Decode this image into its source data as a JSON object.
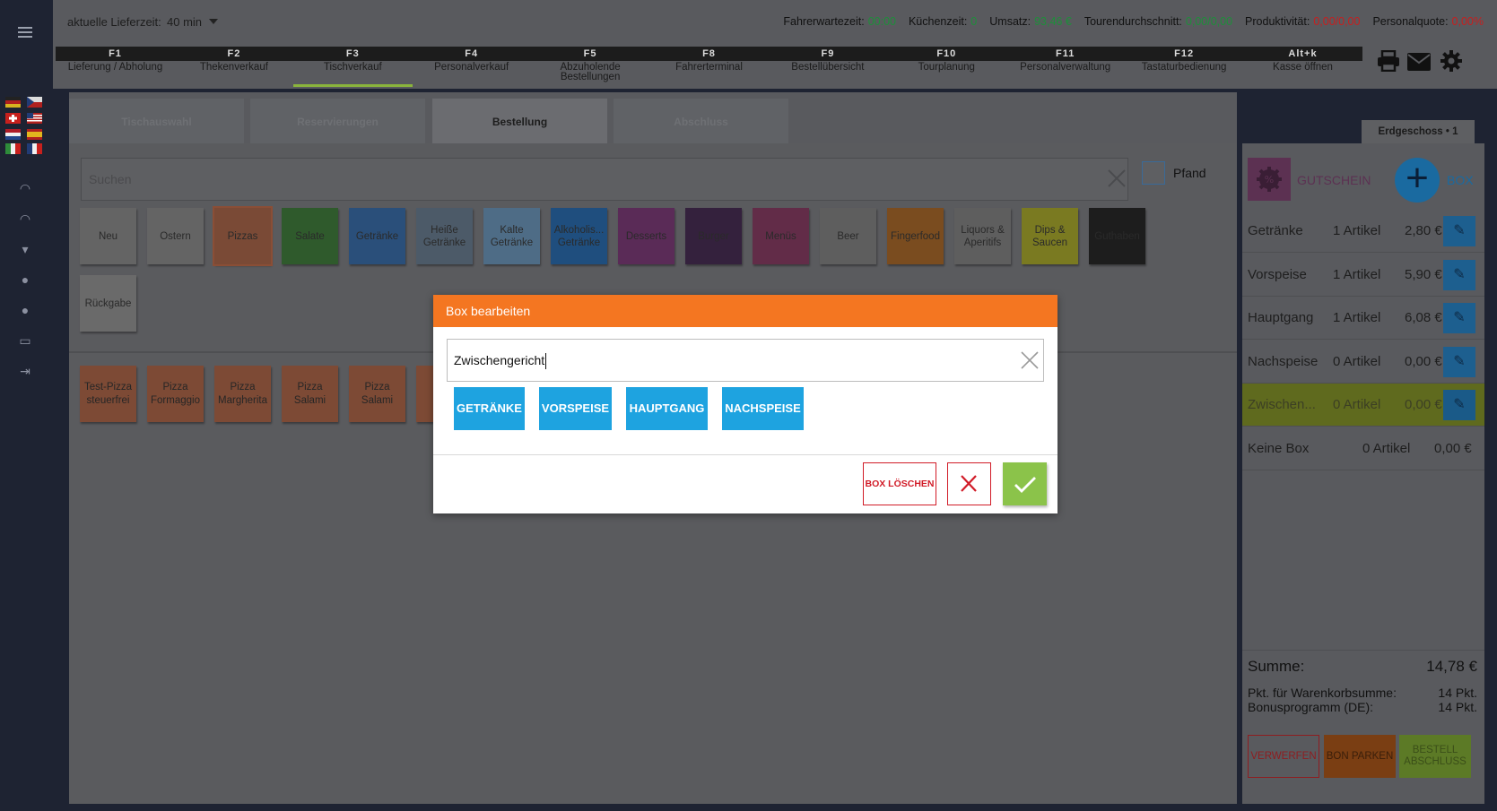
{
  "topbar": {
    "delivery_label": "aktuelle Lieferzeit:",
    "delivery_value": "40 min",
    "stats": [
      {
        "label": "Fahrerwartezeit:",
        "value": "00:00",
        "tone": "g"
      },
      {
        "label": "Küchenzeit:",
        "value": "0",
        "tone": "g"
      },
      {
        "label": "Umsatz:",
        "value": "93,46 €",
        "tone": "g"
      },
      {
        "label": "Tourendurchschnitt:",
        "value": "0,00/0,00",
        "tone": "g"
      },
      {
        "label": "Produktivität:",
        "value": "0,00/0,00",
        "tone": "r"
      },
      {
        "label": "Personalquote:",
        "value": "0,00%",
        "tone": "r"
      }
    ]
  },
  "fkeys": [
    {
      "key": "F1",
      "label": "Lieferung / Abholung"
    },
    {
      "key": "F2",
      "label": "Thekenverkauf"
    },
    {
      "key": "F3",
      "label": "Tischverkauf"
    },
    {
      "key": "F4",
      "label": "Personalverkauf"
    },
    {
      "key": "F5",
      "label": "Abzuholende Bestellungen"
    },
    {
      "key": "F8",
      "label": "Fahrerterminal"
    },
    {
      "key": "F9",
      "label": "Bestellübersicht"
    },
    {
      "key": "F10",
      "label": "Tourplanung"
    },
    {
      "key": "F11",
      "label": "Personalverwaltung"
    },
    {
      "key": "F12",
      "label": "Tastaturbedienung"
    },
    {
      "key": "Alt+k",
      "label": "Kasse öffnen"
    }
  ],
  "tabs": [
    "Tischauswahl",
    "Reservierungen",
    "Bestellung",
    "Abschluss"
  ],
  "search": {
    "placeholder": "Suchen",
    "pfand_label": "Pfand"
  },
  "categories": [
    {
      "label": "Neu",
      "color": "#646464"
    },
    {
      "label": "Ostern",
      "color": "#646464"
    },
    {
      "label": "Pizzas",
      "color": "#7a4a36"
    },
    {
      "label": "Salate",
      "color": "#2f5a2c"
    },
    {
      "label": "Getränke",
      "color": "#2a4f7a"
    },
    {
      "label": "Heiße Getränke",
      "color": "#4c5a68"
    },
    {
      "label": "Kalte Getränke",
      "color": "#4e6c86"
    },
    {
      "label": "Alkoholis... Getränke",
      "color": "#1f4e7e"
    },
    {
      "label": "Desserts",
      "color": "#5a2b57"
    },
    {
      "label": "Burger",
      "color": "#34213d"
    },
    {
      "label": "Menüs",
      "color": "#622c48"
    },
    {
      "label": "Beer",
      "color": "#5e5e5e"
    },
    {
      "label": "Fingerfood",
      "color": "#7a4c1f"
    },
    {
      "label": "Liquors & Aperitifs",
      "color": "#5e5e5e"
    },
    {
      "label": "Dips & Saucen",
      "color": "#7a7a21"
    },
    {
      "label": "Guthaben",
      "color": "#1d1d1d"
    },
    {
      "label": "Rückgabe",
      "color": "#6a6a6a"
    }
  ],
  "items": [
    "Test-Pizza steuerfrei",
    "Pizza Formaggio",
    "Pizza Margherita",
    "Pizza Salami",
    "Pizza Salami"
  ],
  "right": {
    "floor": "Erdgeschoss • 1",
    "gutschein_label": "GUTSCHEIN",
    "box_label": "BOX",
    "boxes": [
      {
        "name": "Getränke",
        "count": "1 Artikel",
        "value": "2,80 €"
      },
      {
        "name": "Vorspeise",
        "count": "1 Artikel",
        "value": "5,90 €"
      },
      {
        "name": "Hauptgang",
        "count": "1 Artikel",
        "value": "6,08 €"
      },
      {
        "name": "Nachspeise",
        "count": "0 Artikel",
        "value": "0,00 €"
      },
      {
        "name": "Zwischen...",
        "count": "0 Artikel",
        "value": "0,00 €"
      },
      {
        "name": "Keine Box",
        "count": "0 Artikel",
        "value": "0,00 €"
      }
    ],
    "summe_label": "Summe:",
    "summe_value": "14,78 €",
    "points_label": "Pkt. für Warenkorbsumme:",
    "points_value": "14 Pkt.",
    "bonus_label": "Bonusprogramm (DE):",
    "bonus_value": "14 Pkt.",
    "btn_discard": "VERWERFEN",
    "btn_park": "BON PARKEN",
    "btn_finish": "BESTELL ABSCHLUSS"
  },
  "modal": {
    "title": "Box bearbeiten",
    "input_value": "Zwischengericht",
    "chips": [
      "GETRÄNKE",
      "VORSPEISE",
      "HAUPTGANG",
      "NACHSPEISE"
    ],
    "delete_label": "BOX LÖSCHEN"
  }
}
